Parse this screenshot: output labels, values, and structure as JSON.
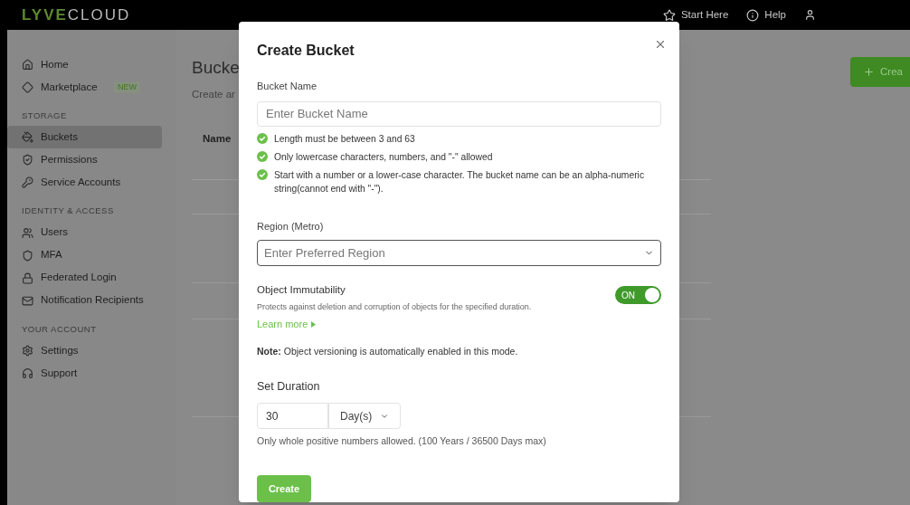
{
  "header": {
    "logo": {
      "brand": "LYVE",
      "product": "CLOUD"
    },
    "links": [
      {
        "kind": "star",
        "label": "Start Here"
      },
      {
        "kind": "info",
        "label": "Help"
      }
    ]
  },
  "sidebar": {
    "items": [
      {
        "label": "Home",
        "selected": false
      },
      {
        "label": "Marketplace",
        "selected": false,
        "badge": "NEW"
      }
    ],
    "sections": [
      {
        "title": "STORAGE",
        "items": [
          {
            "label": "Buckets",
            "selected": true
          },
          {
            "label": "Permissions",
            "selected": false
          },
          {
            "label": "Service Accounts",
            "selected": false
          }
        ]
      },
      {
        "title": "IDENTITY & ACCESS",
        "items": [
          {
            "label": "Users",
            "selected": false
          },
          {
            "label": "MFA",
            "selected": false
          },
          {
            "label": "Federated Login",
            "selected": false
          },
          {
            "label": "Notification Recipients",
            "selected": false
          }
        ]
      },
      {
        "title": "YOUR ACCOUNT",
        "items": [
          {
            "label": "Settings",
            "selected": false
          },
          {
            "label": "Support",
            "selected": false
          }
        ]
      }
    ]
  },
  "page": {
    "title": "Bucke",
    "subtitle": "Create ar",
    "create_button": "Crea",
    "table": {
      "columns": [
        "Name"
      ]
    }
  },
  "dialog": {
    "title": "Create Bucket",
    "bucket_name": {
      "label": "Bucket Name",
      "placeholder": "Enter Bucket Name"
    },
    "rules": [
      {
        "text": "Length must be between 3 and 63",
        "checked": true
      },
      {
        "text": "Only lowercase characters, numbers, and \"-\" allowed",
        "checked": true
      },
      {
        "text": "Start with a number or a lower-case character. The bucket name can be an alpha-numeric string(cannot end with \"-\").",
        "checked": true
      }
    ],
    "region": {
      "label": "Region (Metro)",
      "placeholder": "Enter Preferred Region"
    },
    "immutability": {
      "title": "Object Immutability",
      "description": "Protects against deletion and corruption of objects for the specified duration.",
      "link": "Learn more",
      "on": true,
      "on_label": "ON"
    },
    "note": "**Note:** Object versioning is automatically enabled in this mode.",
    "duration": {
      "title": "Set Duration",
      "value": "30",
      "unit": "Day(s)",
      "hint": "Only whole positive numbers allowed. (100 Years / 36500 Days max)"
    },
    "submit": "Create"
  }
}
